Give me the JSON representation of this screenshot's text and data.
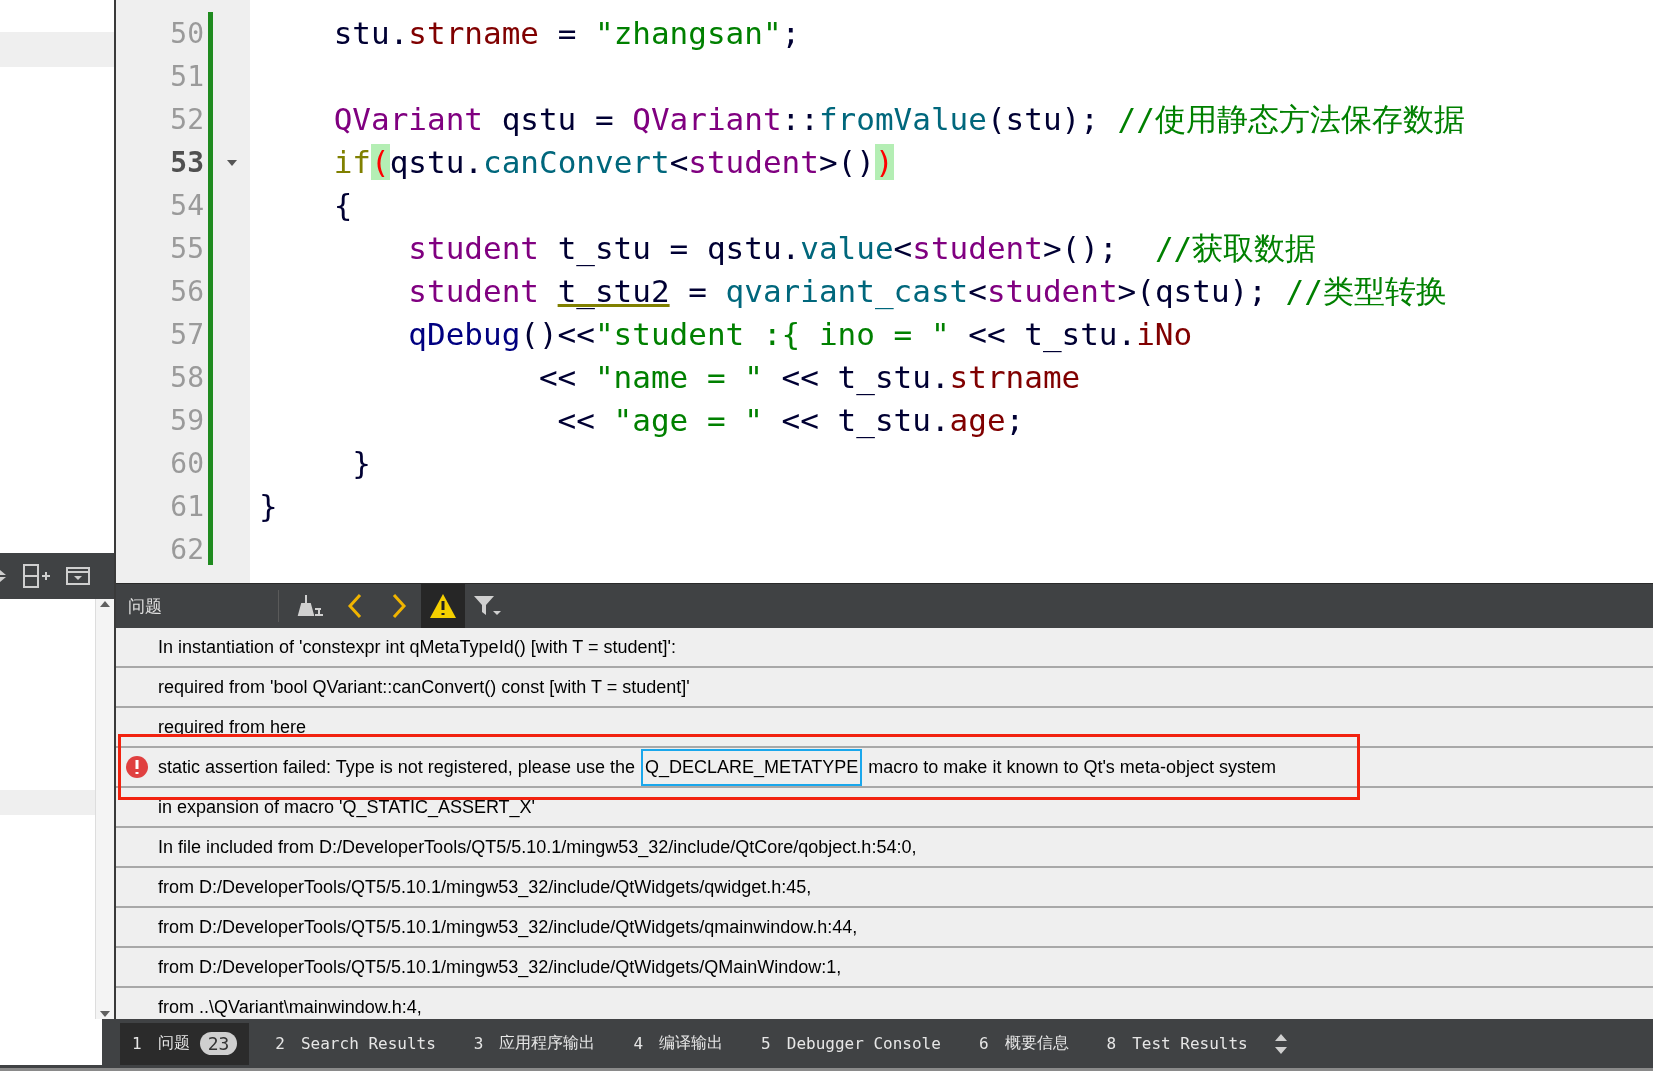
{
  "editor": {
    "lines": [
      {
        "number": "50",
        "current": false,
        "fold": false,
        "tokens": [
          {
            "text": "    stu.",
            "kind": "plain"
          },
          {
            "text": "strname",
            "kind": "field"
          },
          {
            "text": " = ",
            "kind": "plain"
          },
          {
            "text": "\"zhangsan\"",
            "kind": "string"
          },
          {
            "text": ";",
            "kind": "plain"
          }
        ]
      },
      {
        "number": "51",
        "current": false,
        "fold": false
      },
      {
        "number": "52",
        "current": false,
        "fold": false,
        "tokens": [
          {
            "text": "    QVariant",
            "kind": "type"
          },
          {
            "text": " qstu = ",
            "kind": "plain"
          },
          {
            "text": "QVariant",
            "kind": "type"
          },
          {
            "text": "::",
            "kind": "plain"
          },
          {
            "text": "fromValue",
            "kind": "function"
          },
          {
            "text": "(stu); ",
            "kind": "plain"
          },
          {
            "text": "//使用静态方法保存数据",
            "kind": "comment"
          }
        ]
      },
      {
        "number": "53",
        "current": true,
        "fold": true,
        "tokens": [
          {
            "text": "    if",
            "kind": "keyword"
          },
          {
            "text": "(",
            "kind": "match"
          },
          {
            "text": "qstu.",
            "kind": "plain"
          },
          {
            "text": "canConvert",
            "kind": "function"
          },
          {
            "text": "<",
            "kind": "plain"
          },
          {
            "text": "student",
            "kind": "type"
          },
          {
            "text": ">()",
            "kind": "plain"
          },
          {
            "text": ")",
            "kind": "match"
          }
        ]
      },
      {
        "number": "54",
        "current": false,
        "fold": false,
        "tokens": [
          {
            "text": "    {",
            "kind": "plain"
          }
        ]
      },
      {
        "number": "55",
        "current": false,
        "fold": false,
        "tokens": [
          {
            "text": "        student",
            "kind": "type"
          },
          {
            "text": " t_stu = qstu.",
            "kind": "plain"
          },
          {
            "text": "value",
            "kind": "function"
          },
          {
            "text": "<",
            "kind": "plain"
          },
          {
            "text": "student",
            "kind": "type"
          },
          {
            "text": ">();  ",
            "kind": "plain"
          },
          {
            "text": "//获取数据",
            "kind": "comment"
          }
        ]
      },
      {
        "number": "56",
        "current": false,
        "fold": false,
        "tokens": [
          {
            "text": "        student ",
            "kind": "type"
          },
          {
            "text": "t_stu2",
            "kind": "underlined"
          },
          {
            "text": " = ",
            "kind": "plain"
          },
          {
            "text": "qvariant_cast",
            "kind": "function"
          },
          {
            "text": "<",
            "kind": "plain"
          },
          {
            "text": "student",
            "kind": "type"
          },
          {
            "text": ">(qstu); ",
            "kind": "plain"
          },
          {
            "text": "//类型转换",
            "kind": "comment"
          }
        ]
      },
      {
        "number": "57",
        "current": false,
        "fold": false,
        "tokens": [
          {
            "text": "        qDebug",
            "kind": "global"
          },
          {
            "text": "()<<",
            "kind": "plain"
          },
          {
            "text": "\"student :{ ino = \"",
            "kind": "string"
          },
          {
            "text": " << t_stu.",
            "kind": "plain"
          },
          {
            "text": "iNo",
            "kind": "field"
          }
        ]
      },
      {
        "number": "58",
        "current": false,
        "fold": false,
        "tokens": [
          {
            "text": "               << ",
            "kind": "plain"
          },
          {
            "text": "\"name = \"",
            "kind": "string"
          },
          {
            "text": " << t_stu.",
            "kind": "plain"
          },
          {
            "text": "strname",
            "kind": "field"
          }
        ]
      },
      {
        "number": "59",
        "current": false,
        "fold": false,
        "tokens": [
          {
            "text": "                << ",
            "kind": "plain"
          },
          {
            "text": "\"age = \"",
            "kind": "string"
          },
          {
            "text": " << t_stu.",
            "kind": "plain"
          },
          {
            "text": "age",
            "kind": "field"
          },
          {
            "text": ";",
            "kind": "plain"
          }
        ]
      },
      {
        "number": "60",
        "current": false,
        "fold": false,
        "tokens": [
          {
            "text": "     }",
            "kind": "plain"
          }
        ]
      },
      {
        "number": "61",
        "current": false,
        "fold": false,
        "tokens": [
          {
            "text": "}",
            "kind": "plain"
          }
        ]
      },
      {
        "number": "62",
        "current": false,
        "fold": false
      }
    ]
  },
  "issues": {
    "title": "问题",
    "tools": [
      {
        "kind": "clear",
        "selected": false
      },
      {
        "kind": "prev",
        "selected": false
      },
      {
        "kind": "next",
        "selected": false
      },
      {
        "kind": "warning",
        "selected": true
      },
      {
        "kind": "filter",
        "selected": false
      }
    ],
    "rows": [
      {
        "kind": "note",
        "annotated": false,
        "parts": [
          {
            "text": "In instantiation of 'constexpr int qMetaTypeId() [with T = student]':",
            "boxed": false
          }
        ]
      },
      {
        "kind": "note",
        "annotated": false,
        "parts": [
          {
            "text": "required from 'bool QVariant::canConvert() const [with T = student]'",
            "boxed": false
          }
        ]
      },
      {
        "kind": "note",
        "annotated": false,
        "parts": [
          {
            "text": "required from here",
            "boxed": false
          }
        ]
      },
      {
        "kind": "error",
        "annotated": true,
        "parts": [
          {
            "text": "static assertion failed: Type is not registered, please use the ",
            "boxed": false
          },
          {
            "text": "Q_DECLARE_METATYPE",
            "boxed": true
          },
          {
            "text": " macro to make it known to Qt's meta-object system",
            "boxed": false
          }
        ]
      },
      {
        "kind": "note",
        "annotated": false,
        "parts": [
          {
            "text": "in expansion of macro 'Q_STATIC_ASSERT_X'",
            "boxed": false
          }
        ]
      },
      {
        "kind": "note",
        "annotated": false,
        "parts": [
          {
            "text": "In file included from D:/DeveloperTools/QT5/5.10.1/mingw53_32/include/QtCore/qobject.h:54:0,",
            "boxed": false
          }
        ]
      },
      {
        "kind": "note",
        "annotated": false,
        "parts": [
          {
            "text": "from D:/DeveloperTools/QT5/5.10.1/mingw53_32/include/QtWidgets/qwidget.h:45,",
            "boxed": false
          }
        ]
      },
      {
        "kind": "note",
        "annotated": false,
        "parts": [
          {
            "text": "from D:/DeveloperTools/QT5/5.10.1/mingw53_32/include/QtWidgets/qmainwindow.h:44,",
            "boxed": false
          }
        ]
      },
      {
        "kind": "note",
        "annotated": false,
        "parts": [
          {
            "text": "from D:/DeveloperTools/QT5/5.10.1/mingw53_32/include/QtWidgets/QMainWindow:1,",
            "boxed": false
          }
        ]
      },
      {
        "kind": "note",
        "annotated": false,
        "parts": [
          {
            "text": "from ..\\QVariant\\mainwindow.h:4,",
            "boxed": false
          }
        ]
      }
    ]
  },
  "output_tabs": [
    {
      "number": "1",
      "label": "问题",
      "badge": "23",
      "selected": true
    },
    {
      "number": "2",
      "label": "Search Results",
      "selected": false
    },
    {
      "number": "3",
      "label": "应用程序输出",
      "selected": false
    },
    {
      "number": "4",
      "label": "编译输出",
      "selected": false
    },
    {
      "number": "5",
      "label": "Debugger Console",
      "selected": false
    },
    {
      "number": "6",
      "label": "概要信息",
      "selected": false
    },
    {
      "number": "8",
      "label": "Test Results",
      "selected": false
    }
  ]
}
